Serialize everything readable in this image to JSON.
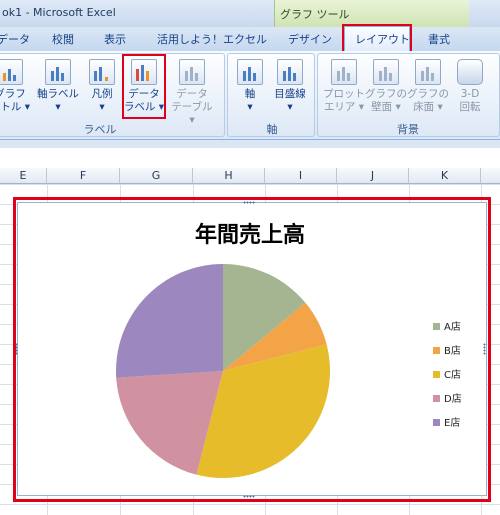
{
  "window": {
    "title": "ok1 - Microsoft Excel",
    "tools_label": "グラフ ツール"
  },
  "tabs": [
    {
      "label": "データ"
    },
    {
      "label": "校閲"
    },
    {
      "label": "表示"
    },
    {
      "label": "活用しよう！エクセル"
    },
    {
      "label": "デザイン"
    },
    {
      "label": "レイアウト",
      "active": true
    },
    {
      "label": "書式"
    }
  ],
  "ribbon": {
    "groups": [
      {
        "label": "ラベル"
      },
      {
        "label": "軸"
      },
      {
        "label": "背景"
      }
    ],
    "buttons": [
      {
        "line1": "グラフ",
        "line2": "イトル ▾"
      },
      {
        "line1": "軸ラベル",
        "line2": "▾"
      },
      {
        "line1": "凡例",
        "line2": "▾"
      },
      {
        "line1": "データ",
        "line2": "ラベル ▾"
      },
      {
        "line1": "データ",
        "line2": "テーブル ▾"
      },
      {
        "line1": "軸",
        "line2": "▾"
      },
      {
        "line1": "目盛線",
        "line2": "▾"
      },
      {
        "line1": "プロット",
        "line2": "エリア ▾"
      },
      {
        "line1": "グラフの",
        "line2": "壁面 ▾"
      },
      {
        "line1": "グラフの",
        "line2": "床面 ▾"
      },
      {
        "line1": "3-D",
        "line2": "回転"
      }
    ]
  },
  "columns": [
    "E",
    "F",
    "G",
    "H",
    "I",
    "J",
    "K"
  ],
  "colors": {
    "highlight": "#e0001a"
  },
  "chart_data": {
    "type": "pie",
    "title": "年間売上高",
    "legend_position": "right",
    "categories": [
      "A店",
      "B店",
      "C店",
      "D店",
      "E店"
    ],
    "values": [
      14,
      7,
      33,
      20,
      26
    ],
    "colors": [
      "#a5b592",
      "#f3a447",
      "#e6bc2a",
      "#d091a0",
      "#9c88be"
    ]
  }
}
